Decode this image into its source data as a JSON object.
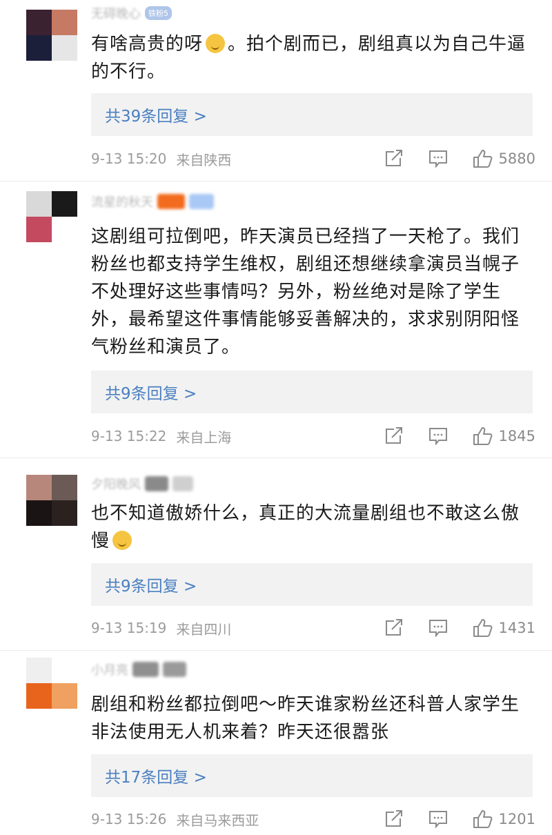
{
  "comments": [
    {
      "name_hint": "无碍晚心",
      "badge": "铁粉5",
      "text_pre": "有啥高贵的呀",
      "text_post": "。拍个剧而已，剧组真以为自己牛逼的不行。",
      "reply_label": "共39条回复 >",
      "time": "9-13 15:20",
      "location": "来自陕西",
      "likes": "5880",
      "avatar_colors": [
        "#3a2230",
        "#c67a63",
        "#1b1f3a",
        "#e6e6e6"
      ]
    },
    {
      "name_hint": "流星的秋天",
      "text": "这剧组可拉倒吧，昨天演员已经挡了一天枪了。我们粉丝也都支持学生维权，剧组还想继续拿演员当幌子不处理好这些事情吗？另外，粉丝绝对是除了学生外，最希望这件事情能够妥善解决的，求求别阴阳怪气粉丝和演员了。",
      "reply_label": "共9条回复 >",
      "time": "9-13 15:22",
      "location": "来自上海",
      "likes": "1845",
      "avatar_colors": [
        "#d9d9d9",
        "#1a1a1a",
        "#c44a60",
        "#ffffff"
      ]
    },
    {
      "name_hint": "夕阳晚风",
      "text_pre": "也不知道傲娇什么，真正的大流量剧组也不敢这么傲慢",
      "reply_label": "共9条回复 >",
      "time": "9-13 15:19",
      "location": "来自四川",
      "likes": "1431",
      "avatar_colors": [
        "#b8877c",
        "#6b5a55",
        "#1a1414",
        "#2b2220"
      ]
    },
    {
      "name_hint": "小月亮",
      "text": "剧组和粉丝都拉倒吧～昨天谁家粉丝还科普人家学生非法使用无人机来着？昨天还很嚣张",
      "reply_label": "共17条回复 >",
      "time": "9-13 15:26",
      "location": "来自马来西亚",
      "likes": "1201",
      "avatar_colors": [
        "#efefef",
        "#ffffff",
        "#e8641c",
        "#f0a060"
      ]
    }
  ],
  "icons": {
    "share": "share-icon",
    "comment": "comment-icon",
    "like": "thumbs-up-icon"
  },
  "colors": {
    "reply_link": "#4a7fc1",
    "meta_text": "#9b9b9b",
    "reply_bg": "#f2f2f2"
  }
}
